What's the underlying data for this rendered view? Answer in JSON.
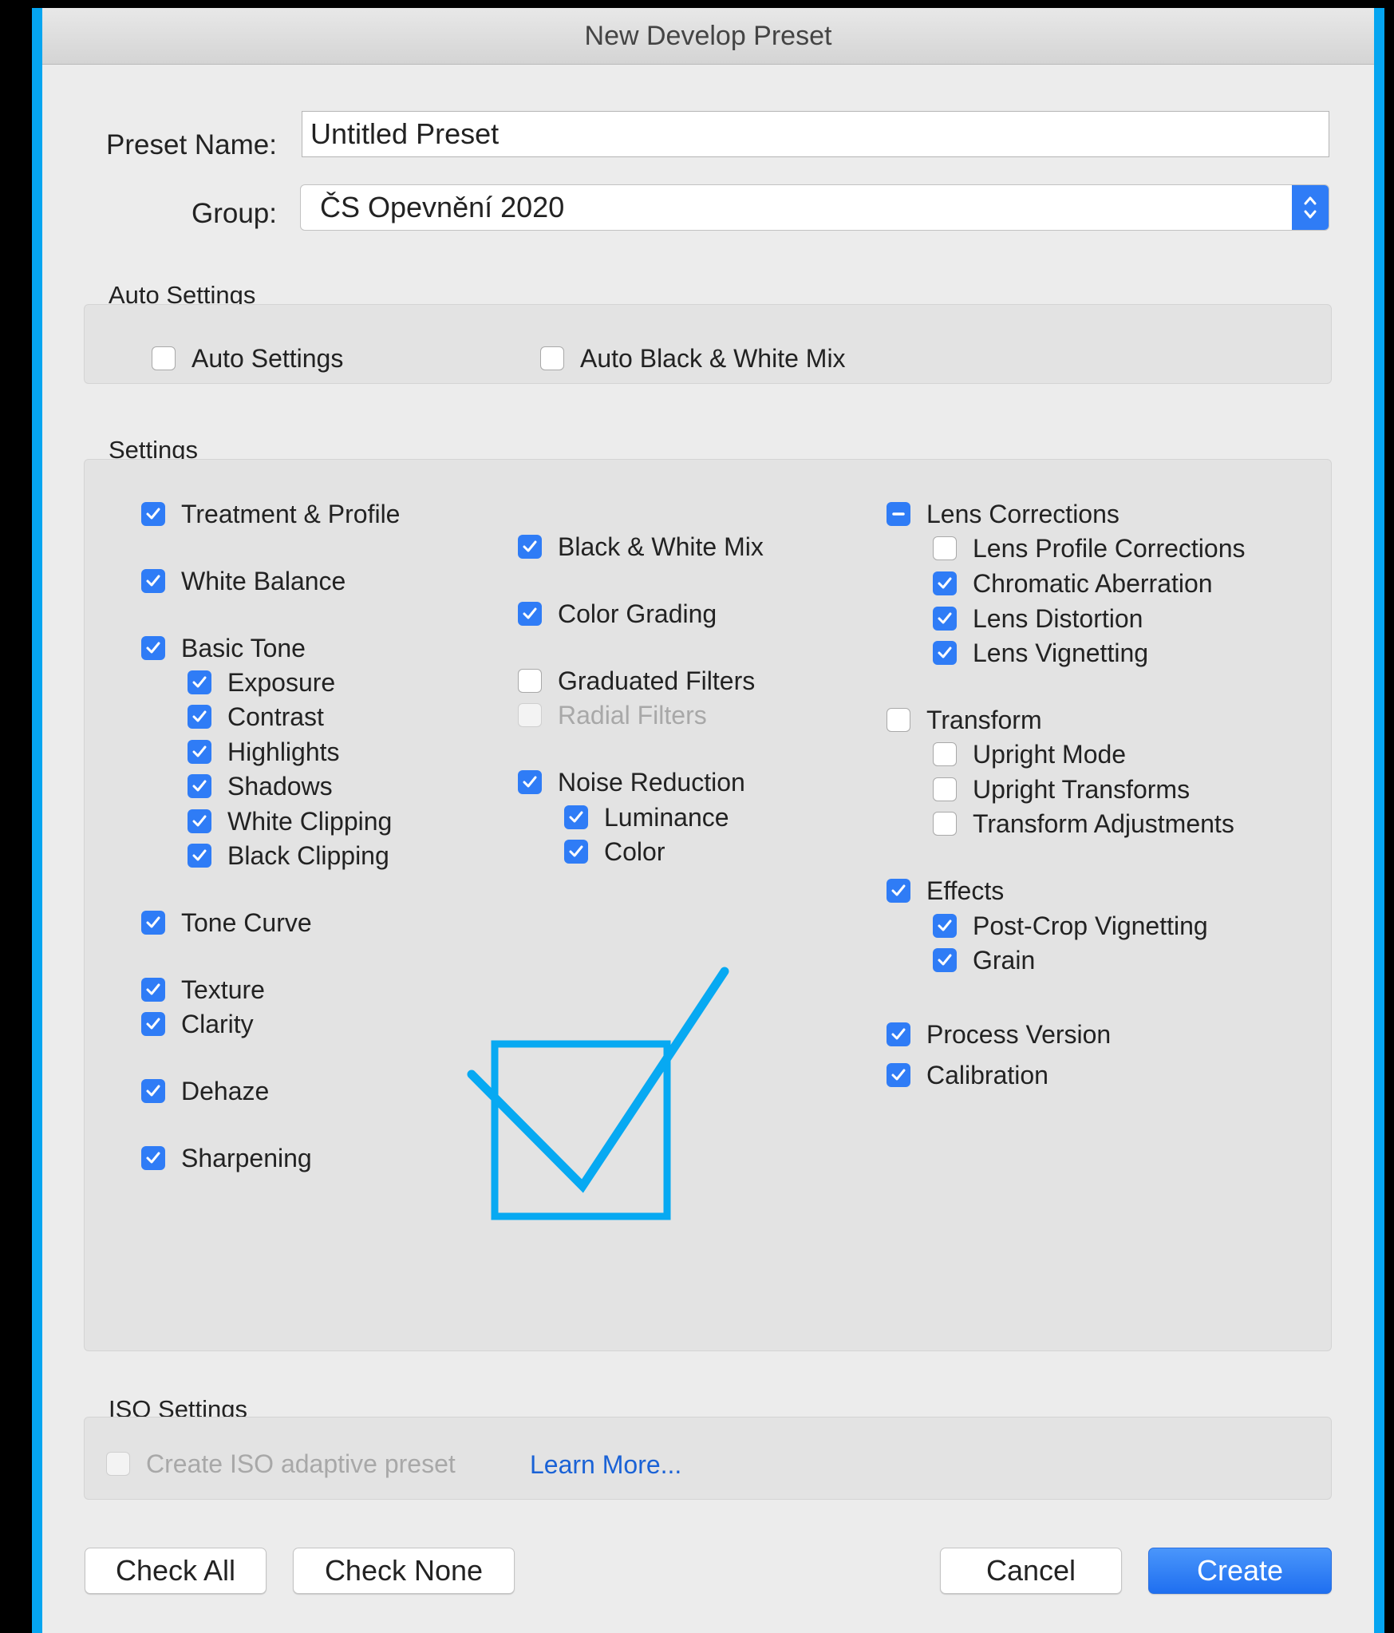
{
  "window": {
    "title": "New Develop Preset"
  },
  "form": {
    "preset_name_label": "Preset Name:",
    "preset_name_value": "Untitled Preset",
    "group_label": "Group:",
    "group_value": "ČS Opevnění 2020"
  },
  "auto_settings": {
    "heading": "Auto Settings",
    "items": [
      {
        "label": "Auto Settings",
        "state": "unchecked"
      },
      {
        "label": "Auto Black & White Mix",
        "state": "unchecked"
      }
    ]
  },
  "settings": {
    "heading": "Settings",
    "col1": [
      {
        "label": "Treatment & Profile",
        "state": "checked"
      },
      {
        "label": "White Balance",
        "state": "checked"
      },
      {
        "label": "Basic Tone",
        "state": "checked"
      },
      {
        "label": "Exposure",
        "state": "checked"
      },
      {
        "label": "Contrast",
        "state": "checked"
      },
      {
        "label": "Highlights",
        "state": "checked"
      },
      {
        "label": "Shadows",
        "state": "checked"
      },
      {
        "label": "White Clipping",
        "state": "checked"
      },
      {
        "label": "Black Clipping",
        "state": "checked"
      },
      {
        "label": "Tone Curve",
        "state": "checked"
      },
      {
        "label": "Texture",
        "state": "checked"
      },
      {
        "label": "Clarity",
        "state": "checked"
      },
      {
        "label": "Dehaze",
        "state": "checked"
      },
      {
        "label": "Sharpening",
        "state": "checked"
      }
    ],
    "col2": [
      {
        "label": "Black  &  White Mix",
        "state": "checked"
      },
      {
        "label": "Color Grading",
        "state": "checked"
      },
      {
        "label": "Graduated Filters",
        "state": "unchecked"
      },
      {
        "label": "Radial Filters",
        "state": "disabled"
      },
      {
        "label": "Noise Reduction",
        "state": "checked"
      },
      {
        "label": "Luminance",
        "state": "checked"
      },
      {
        "label": "Color",
        "state": "checked"
      }
    ],
    "col3": [
      {
        "label": "Lens Corrections",
        "state": "mixed"
      },
      {
        "label": "Lens Profile Corrections",
        "state": "unchecked"
      },
      {
        "label": "Chromatic Aberration",
        "state": "checked"
      },
      {
        "label": "Lens Distortion",
        "state": "checked"
      },
      {
        "label": "Lens Vignetting",
        "state": "checked"
      },
      {
        "label": "Transform",
        "state": "unchecked"
      },
      {
        "label": "Upright Mode",
        "state": "unchecked"
      },
      {
        "label": "Upright Transforms",
        "state": "unchecked"
      },
      {
        "label": "Transform Adjustments",
        "state": "unchecked"
      },
      {
        "label": "Effects",
        "state": "checked"
      },
      {
        "label": "Post-Crop Vignetting",
        "state": "checked"
      },
      {
        "label": "Grain",
        "state": "checked"
      },
      {
        "label": "Process Version",
        "state": "checked"
      },
      {
        "label": "Calibration",
        "state": "checked"
      }
    ]
  },
  "iso": {
    "heading": "ISO Settings",
    "adaptive_label": "Create ISO adaptive preset",
    "adaptive_state": "disabled",
    "learn_more": "Learn More..."
  },
  "buttons": {
    "check_all": "Check All",
    "check_none": "Check None",
    "cancel": "Cancel",
    "create": "Create"
  },
  "colors": {
    "frame_blue": "#05a5f0",
    "checkbox_blue": "#2f7cf6",
    "overlay_blue": "#07a9f2"
  },
  "overlay": {
    "icon": "checkbox-check-icon"
  }
}
